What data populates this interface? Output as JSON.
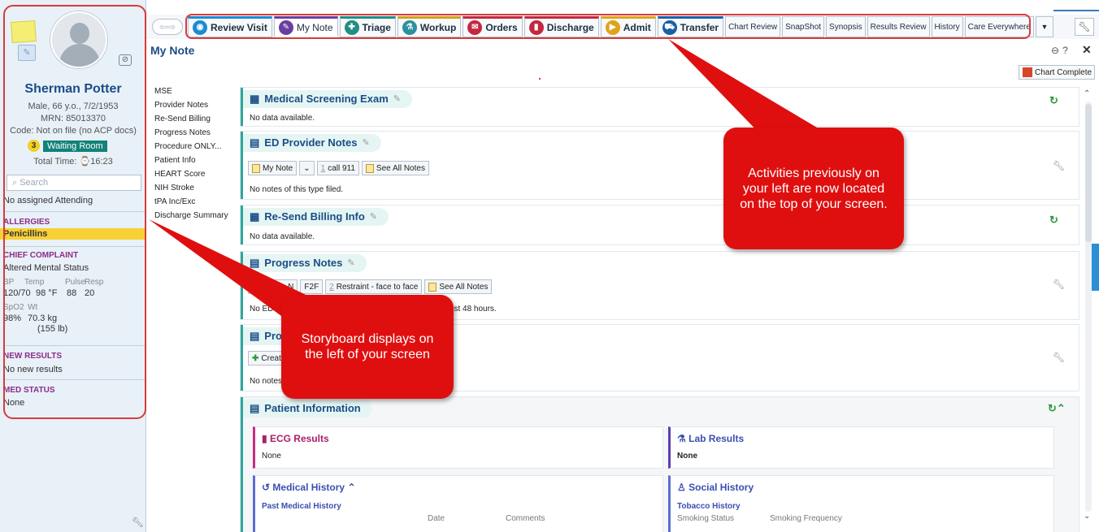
{
  "storyboard": {
    "patient_name": "Sherman Potter",
    "demographics": "Male, 66 y.o., 7/2/1953",
    "mrn": "MRN: 85013370",
    "code_status": "Code: Not on file (no ACP docs)",
    "acuity": "3",
    "location": "Waiting Room",
    "total_time": "Total Time: ⌚16:23",
    "search_placeholder": "Search",
    "attending": "No assigned Attending",
    "allergies_label": "ALLERGIES",
    "allergy": "Penicillins",
    "chief_complaint_label": "CHIEF COMPLAINT",
    "chief_complaint": "Altered Mental Status",
    "vitals": {
      "bp_label": "BP",
      "bp": "120/70",
      "temp_label": "Temp",
      "temp": "98 °F",
      "pulse_label": "Pulse",
      "pulse": "88",
      "resp_label": "Resp",
      "resp": "20",
      "spo2_label": "SpO2",
      "spo2": "98%",
      "wt_label": "Wt",
      "wt": "70.3 kg",
      "wt_lb": "(155 lb)"
    },
    "new_results_label": "NEW RESULTS",
    "new_results": "No new results",
    "med_status_label": "MED STATUS",
    "med_status": "None"
  },
  "tabs": [
    {
      "label": "Review Visit",
      "icon": "review-visit-icon",
      "color": "#1c8ad4"
    },
    {
      "label": "My Note",
      "icon": "my-note-icon",
      "color": "#6b3fa0"
    },
    {
      "label": "Triage",
      "icon": "triage-icon",
      "color": "#1f8e83"
    },
    {
      "label": "Workup",
      "icon": "workup-icon",
      "color": "#d0a01c"
    },
    {
      "label": "Orders",
      "icon": "orders-icon",
      "color": "#c3283e"
    },
    {
      "label": "Discharge",
      "icon": "discharge-icon",
      "color": "#c3283e"
    },
    {
      "label": "Admit",
      "icon": "admit-icon",
      "color": "#e0a21b"
    },
    {
      "label": "Transfer",
      "icon": "transfer-icon",
      "color": "#1b5fa8"
    }
  ],
  "small_tabs": [
    "Chart Review",
    "SnapShot",
    "Synopsis",
    "Results Review",
    "History",
    "Care Everywhere"
  ],
  "activity_title": "My Note",
  "chart_complete": "Chart Complete",
  "section_nav": [
    "MSE",
    "Provider Notes",
    "Re-Send Billing",
    "Progress Notes",
    "Procedure ONLY...",
    "Patient Info",
    "HEART Score",
    "NIH Stroke",
    "tPA Inc/Exc",
    "Discharge Summary"
  ],
  "sections": {
    "mse": {
      "title": "Medical Screening Exam",
      "text": "No data available."
    },
    "provider_notes": {
      "title": "ED Provider Notes",
      "btn_my_note": "My Note",
      "btn_num": "1",
      "btn_call": "call 911",
      "btn_see_all": "See All Notes",
      "text": "No notes of this type filed."
    },
    "billing": {
      "title": "Re-Send Billing Info",
      "text": "No data available."
    },
    "progress": {
      "title": "Progress Notes",
      "btn_create": "Create N",
      "btn_f2f": "F2F",
      "btn_num": "2",
      "btn_restraint": "Restraint - face to face",
      "btn_see_all": "See All Notes",
      "text_a": "No ED Pro",
      "text_b": "the last 48 hours."
    },
    "procedure": {
      "title": "Proc",
      "btn_create": "Create",
      "text": "No notes"
    },
    "patient_info": {
      "title": "Patient Information"
    }
  },
  "panels": {
    "ecg": {
      "title": "ECG Results",
      "value": "None"
    },
    "lab": {
      "title": "Lab Results",
      "value": "None"
    },
    "medical_history": {
      "title": "Medical History",
      "sub": "Past Medical History",
      "col_date": "Date",
      "col_comments": "Comments"
    },
    "social_history": {
      "title": "Social History",
      "sub": "Tobacco History",
      "col_smoking_status": "Smoking Status",
      "col_smoking_freq": "Smoking Frequency"
    }
  },
  "callouts": {
    "activities": "Activities previously on your left are now located on the top of your screen.",
    "storyboard": "Storyboard displays on the left of your screen"
  },
  "colors": {
    "brand_blue": "#1a4d86",
    "callout_red": "#e00f0f",
    "frame_red": "#d63c3c",
    "teal": "#2ea79c",
    "allergy_yellow": "#f7d136"
  }
}
